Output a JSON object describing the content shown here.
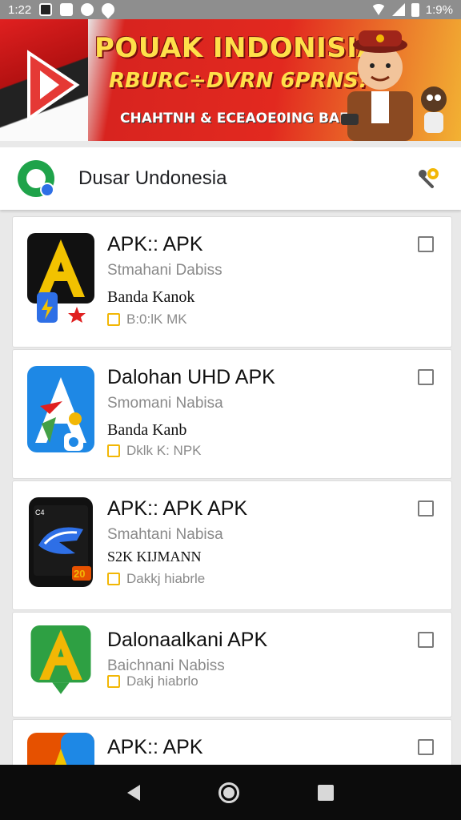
{
  "status_bar": {
    "time": "1:22",
    "battery": "1:9%"
  },
  "banner": {
    "title": "POUAK INDONISIAI",
    "subtitle": "RBURC÷DVRN 6PRNS!",
    "tagline": "CHAHTNH & ECEAOE0ING BAEZRI!"
  },
  "header": {
    "title": "Dusar Undonesia"
  },
  "apps": [
    {
      "title": "APK:: APK",
      "developer": "Stmahani Dabiss",
      "extra": "Banda Kanok",
      "badge": "B:0:lK MK"
    },
    {
      "title": "Dalohan UHD APK",
      "developer": "Smomani Nabisa",
      "extra": "Banda Kanb",
      "badge": "Dklk K: NPK"
    },
    {
      "title": "APK:: APK APK",
      "developer": "Smahtani Nabisa",
      "extra": "S2K KIJMANN",
      "badge": "Dakkj hiabrle"
    },
    {
      "title": "Dalonaalkani APK",
      "developer": "Baichnani Nabiss",
      "extra": "",
      "badge": "Dakj hiabrlo"
    },
    {
      "title": "APK:: APK",
      "developer": "",
      "extra": "",
      "badge": ""
    }
  ],
  "colors": {
    "accent_yellow": "#f2b705",
    "brand_green": "#1fa34a",
    "banner_red": "#d8241f"
  }
}
